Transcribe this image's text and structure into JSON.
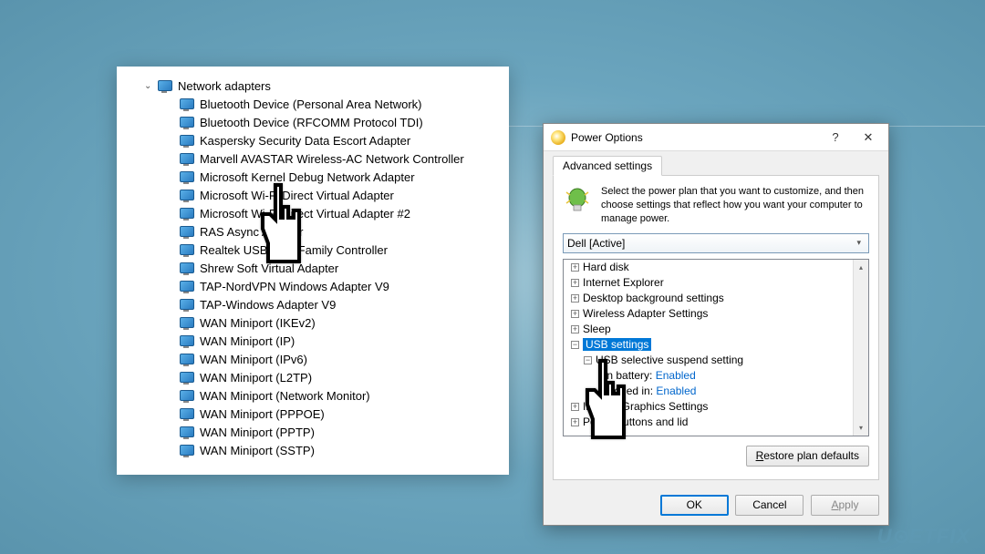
{
  "device_manager": {
    "category": "Network adapters",
    "items": [
      "Bluetooth Device (Personal Area Network)",
      "Bluetooth Device (RFCOMM Protocol TDI)",
      "Kaspersky Security Data Escort Adapter",
      "Marvell AVASTAR Wireless-AC Network Controller",
      "Microsoft Kernel Debug Network Adapter",
      "Microsoft Wi-Fi Direct Virtual Adapter",
      "Microsoft Wi-Fi Direct Virtual Adapter #2",
      "RAS Async Adapter",
      "Realtek USB GbE Family Controller",
      "Shrew Soft Virtual Adapter",
      "TAP-NordVPN Windows Adapter V9",
      "TAP-Windows Adapter V9",
      "WAN Miniport (IKEv2)",
      "WAN Miniport (IP)",
      "WAN Miniport (IPv6)",
      "WAN Miniport (L2TP)",
      "WAN Miniport (Network Monitor)",
      "WAN Miniport (PPPOE)",
      "WAN Miniport (PPTP)",
      "WAN Miniport (SSTP)"
    ]
  },
  "power_options": {
    "title": "Power Options",
    "tab": "Advanced settings",
    "description": "Select the power plan that you want to customize, and then choose settings that reflect how you want your computer to manage power.",
    "plan": "Dell [Active]",
    "tree": {
      "hard_disk": "Hard disk",
      "ie": "Internet Explorer",
      "desktop_bg": "Desktop background settings",
      "wireless": "Wireless Adapter Settings",
      "sleep": "Sleep",
      "usb": "USB settings",
      "usb_sel": "USB selective suspend setting",
      "on_batt_label": "On battery:",
      "on_batt_val": "Enabled",
      "plugged_label": "Plugged in:",
      "plugged_val": "Enabled",
      "graphics": "Intel(R) Graphics Settings",
      "power_lid": "Power buttons and lid"
    },
    "restore": "Restore plan defaults",
    "ok": "OK",
    "cancel": "Cancel",
    "apply": "Apply"
  },
  "watermark": "UGETFIX"
}
